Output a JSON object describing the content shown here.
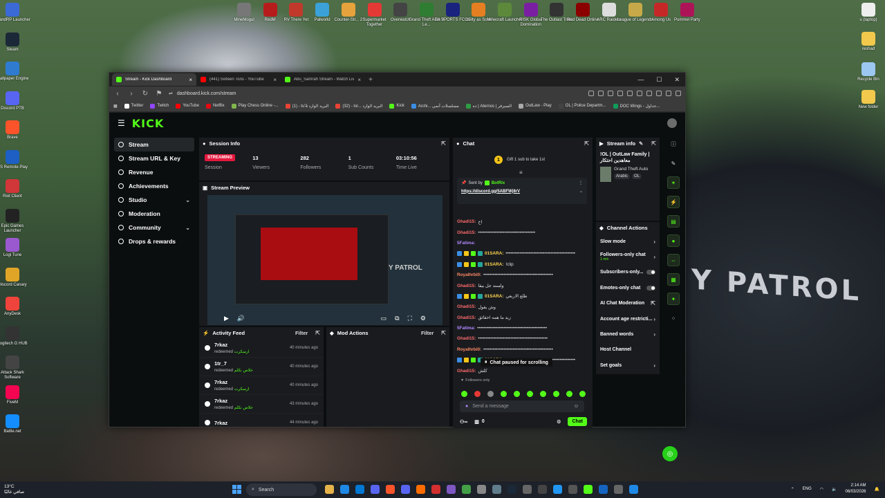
{
  "desktop_left": [
    {
      "label": "GrandRP Launcher",
      "color": "#3b6ad6"
    },
    {
      "label": "Steam",
      "color": "#1b2838"
    },
    {
      "label": "Wallpaper Engine",
      "color": "#2f7bd0"
    },
    {
      "label": "Discord PTB",
      "color": "#5865f2"
    },
    {
      "label": "Brave",
      "color": "#fb542b"
    },
    {
      "label": "PS Remote Play",
      "color": "#1d5fc4"
    },
    {
      "label": "Riot Client",
      "color": "#d13639"
    },
    {
      "label": "Epic Games Launcher",
      "color": "#222"
    },
    {
      "label": "Logi Tune",
      "color": "#9b59d0"
    },
    {
      "label": "Discord Canary",
      "color": "#e0a526"
    },
    {
      "label": "AnyDesk",
      "color": "#ef443b"
    },
    {
      "label": "Logitech G HUB",
      "color": "#333"
    },
    {
      "label": "Attack Shark Software",
      "color": "#444"
    },
    {
      "label": "FiveM",
      "color": "#f40552"
    },
    {
      "label": "Battle.net",
      "color": "#148eff"
    }
  ],
  "desktop_top": [
    {
      "label": "MineMogul",
      "color": "#777"
    },
    {
      "label": "RedM",
      "color": "#b71c1c"
    },
    {
      "label": "RV There Yet",
      "color": "#c0392b"
    },
    {
      "label": "Palworld",
      "color": "#3ba1d8"
    },
    {
      "label": "Counter-Str... 2",
      "color": "#e6a23c"
    },
    {
      "label": "Supermarket Together",
      "color": "#e53935"
    },
    {
      "label": "Overwatch",
      "color": "#444"
    },
    {
      "label": "Grand Theft Auto V Le...",
      "color": "#2e7d32"
    },
    {
      "label": "EA SPORTS FC 25",
      "color": "#1a237e"
    },
    {
      "label": "Guilty as Sock!",
      "color": "#e67e22"
    },
    {
      "label": "Minecraft Launcher",
      "color": "#5d8a3a"
    },
    {
      "label": "RISK Global Domination",
      "color": "#7b1fa2"
    },
    {
      "label": "The Outlast Trials",
      "color": "#333"
    },
    {
      "label": "Red Dead Online",
      "color": "#8b0000"
    },
    {
      "label": "ARC Raiders",
      "color": "#ddd"
    },
    {
      "label": "League of Legends",
      "color": "#c8a94a"
    },
    {
      "label": "Among Us",
      "color": "#c62828"
    },
    {
      "label": "Pummel Party",
      "color": "#ad1457"
    }
  ],
  "desktop_right": [
    {
      "label": "u (laptop)",
      "color": "#eee"
    },
    {
      "label": "reshad",
      "color": "#f2c94c"
    },
    {
      "label": "Recycle Bin",
      "color": "#9bc7f0"
    },
    {
      "label": "New folder",
      "color": "#f2c94c"
    }
  ],
  "browser": {
    "tabs": [
      {
        "title": "Stream - Kick Dashboard",
        "color": "#53fc18",
        "active": true
      },
      {
        "title": "(441) Sixteen Tons - YouTube",
        "color": "#ff0000",
        "active": false
      },
      {
        "title": "Abu_Samrah Stream - Watch Live",
        "color": "#53fc18",
        "active": false
      }
    ],
    "url": "dashboard.kick.com/stream",
    "bookmarks": [
      {
        "label": "Twitter",
        "color": "#fff"
      },
      {
        "label": "Twitch",
        "color": "#9146ff"
      },
      {
        "label": "YouTube",
        "color": "#ff0000"
      },
      {
        "label": "Netflix",
        "color": "#e50914"
      },
      {
        "label": "Play Chess Online -...",
        "color": "#81b64c"
      },
      {
        "label": "(1) - tu'ä البريد الوارد",
        "color": "#ea4335"
      },
      {
        "label": "(32) - lor... البريد الوارد",
        "color": "#ea4335"
      },
      {
        "label": "Kick",
        "color": "#53fc18"
      },
      {
        "label": "Archi... مسلسلات أنمي",
        "color": "#3a8ee6"
      },
      {
        "label": "ده | Aternos | السيرفر",
        "color": "#2f9e44"
      },
      {
        "label": "OutLaw - Play",
        "color": "#aaa"
      },
      {
        "label": "OL | Police Departm...",
        "color": "#444"
      },
      {
        "label": "DOC Wings - جداول...",
        "color": "#0f9d58"
      }
    ]
  },
  "kick": {
    "logo": "KICK",
    "sidebar": [
      {
        "label": "Stream",
        "active": true,
        "expand": false
      },
      {
        "label": "Stream URL & Key",
        "active": false,
        "expand": false
      },
      {
        "label": "Revenue",
        "active": false,
        "expand": false
      },
      {
        "label": "Achievements",
        "active": false,
        "expand": false
      },
      {
        "label": "Studio",
        "active": false,
        "expand": true
      },
      {
        "label": "Moderation",
        "active": false,
        "expand": false
      },
      {
        "label": "Community",
        "active": false,
        "expand": true
      },
      {
        "label": "Drops & rewards",
        "active": false,
        "expand": false
      }
    ],
    "session": {
      "title": "Session Info",
      "stats": [
        {
          "value": "STREAMING",
          "label": "Session",
          "badge": true
        },
        {
          "value": "13",
          "label": "Viewers",
          "badge": false
        },
        {
          "value": "282",
          "label": "Followers",
          "badge": false
        },
        {
          "value": "1",
          "label": "Sub Counts",
          "badge": false
        },
        {
          "value": "03:10:56",
          "label": "Time Live",
          "badge": false
        }
      ]
    },
    "preview": {
      "title": "Stream Preview",
      "overlay_text": "Y PATROL"
    },
    "activity": {
      "title": "Activity Feed",
      "filter": "Filter",
      "items": [
        {
          "user": "7rkaz",
          "action": "redeemed",
          "reward": "ارسكرت",
          "time": "40 minutes ago"
        },
        {
          "user": "1tr_7",
          "action": "redeemed",
          "reward": "خلاص نكلم",
          "time": "40 minutes ago"
        },
        {
          "user": "7rkaz",
          "action": "redeemed",
          "reward": "ارسكرت",
          "time": "40 minutes ago"
        },
        {
          "user": "7rkaz",
          "action": "redeemed",
          "reward": "خلاص نكلم",
          "time": "43 minutes ago"
        },
        {
          "user": "7rkaz",
          "action": "",
          "reward": "",
          "time": "44 minutes ago"
        }
      ]
    },
    "mod_actions": {
      "title": "Mod Actions",
      "filter": "Filter"
    },
    "chat": {
      "title": "Chat",
      "gift_text": "Gift 1 sub to take 1st",
      "gift_count": "1",
      "pinned_by": "Sent by",
      "pinned_user": "BotRix",
      "pinned_link": "https://discord.gg/5ABFWj8rV",
      "messages": [
        {
          "user": "Ghadi15:",
          "color": "#ff6b6b",
          "text": "اخ",
          "badges": 0
        },
        {
          "user": "Ghadi15:",
          "color": "#ff6b6b",
          "text": "•••••••••••••••••••••••••••••••••••••",
          "badges": 0
        },
        {
          "user": "5Fatima:",
          "color": "#b388ff",
          "text": "",
          "badges": 0
        },
        {
          "user": "01SARA:",
          "color": "#ffd54f",
          "text": "•••••••••••••••••••••••••••••••••••••••••••••",
          "badges": 4
        },
        {
          "user": "01SARA:",
          "color": "#ffd54f",
          "text": "!clip",
          "badges": 4
        },
        {
          "user": "Royalhrbi0:",
          "color": "#ff8a65",
          "text": "•••••••••••••••••••••••••••••••••••••••••••••",
          "badges": 0
        },
        {
          "user": "Ghadi15:",
          "color": "#ff6b6b",
          "text": "ولسند جل بيقا",
          "badges": 0
        },
        {
          "user": "01SARA:",
          "color": "#ffd54f",
          "text": "طلع الاربعي",
          "badges": 4
        },
        {
          "user": "Ghadi15:",
          "color": "#ff6b6b",
          "text": "وش يقول",
          "badges": 0
        },
        {
          "user": "Ghadi15:",
          "color": "#ff6b6b",
          "text": "زيد ما همه احقائق",
          "badges": 0
        },
        {
          "user": "5Fatima:",
          "color": "#b388ff",
          "text": "•••••••••••••••••••••••••••••••••••••••••••••",
          "badges": 0
        },
        {
          "user": "Ghadi15:",
          "color": "#ff6b6b",
          "text": "•••••••••••••••••••••••••••••••••••••••••••••",
          "badges": 0
        },
        {
          "user": "Royalhrbi0:",
          "color": "#ff8a65",
          "text": "•••••••••••••••••••••••••••••••••••••••••••••",
          "badges": 0
        },
        {
          "user": "01SARA:",
          "color": "#ffd54f",
          "text": "•••••••••••••••••••••••••••••••••••••••••••••",
          "badges": 4
        },
        {
          "user": "Ghadi15:",
          "color": "#ff6b6b",
          "text": "كلش",
          "badges": 0
        }
      ],
      "paused_text": "Chat paused for scrolling",
      "followers_only": "Followers only",
      "input_placeholder": "Send a message",
      "count": "0",
      "send_label": "Chat"
    },
    "stream_info": {
      "title": "Stream info",
      "stream_title": "!OL | OutLaw Family | معاهدين احتكار",
      "category": "Grand Theft Auto",
      "tags": [
        "Arabic",
        "OL"
      ]
    },
    "channel_actions": {
      "title": "Channel Actions",
      "items": [
        {
          "label": "Slow mode",
          "type": "chevron",
          "sub": ""
        },
        {
          "label": "Followers-only chat",
          "type": "chevron",
          "sub": "1 min"
        },
        {
          "label": "Subscribers-only...",
          "type": "toggle",
          "sub": ""
        },
        {
          "label": "Emotes-only chat",
          "type": "toggle",
          "sub": ""
        },
        {
          "label": "AI Chat Moderation",
          "type": "external",
          "sub": ""
        },
        {
          "label": "Account age restricti...",
          "type": "chevron",
          "sub": ""
        },
        {
          "label": "Banned words",
          "type": "chevron",
          "sub": ""
        },
        {
          "label": "Host Channel",
          "type": "none",
          "sub": ""
        },
        {
          "label": "Set goals",
          "type": "chevron",
          "sub": ""
        }
      ]
    }
  },
  "taskbar": {
    "temp": "13°C",
    "weather": "صافي غالبًا",
    "search": "Search",
    "lang": "ENG",
    "time": "2:14 AM",
    "date": "06/03/2026"
  }
}
